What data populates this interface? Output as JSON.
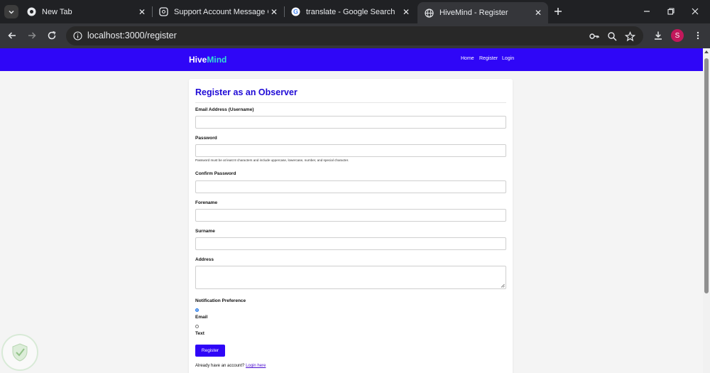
{
  "browser": {
    "tabs": [
      {
        "title": "New Tab",
        "icon": "chrome-icon",
        "active": false
      },
      {
        "title": "Support Account Message Click",
        "icon": "openai-icon",
        "active": false
      },
      {
        "title": "translate - Google Search",
        "icon": "google-icon",
        "active": false
      },
      {
        "title": "HiveMind - Register",
        "icon": "globe-icon",
        "active": true
      }
    ],
    "url": "localhost:3000/register",
    "profile_initial": "S"
  },
  "site": {
    "brand_part1": "Hive",
    "brand_part2": "Mind",
    "nav": {
      "home": "Home",
      "register": "Register",
      "login": "Login"
    },
    "colors": {
      "header": "#2f06f7",
      "brand_accent": "#33e0d5",
      "title": "#1f0ad6"
    }
  },
  "form": {
    "title": "Register as an Observer",
    "email_label": "Email Address (Username)",
    "password_label": "Password",
    "password_hint": "Password must be at least 8 characters and include uppercase, lowercase, number, and special character.",
    "confirm_label": "Confirm Password",
    "forename_label": "Forename",
    "surname_label": "Surname",
    "address_label": "Address",
    "notification_label": "Notification Preference",
    "options": {
      "email": "Email",
      "text": "Text"
    },
    "selected_option": "Email",
    "submit_label": "Register",
    "footer_prefix": "Already have an account?",
    "footer_link": "Login here"
  }
}
